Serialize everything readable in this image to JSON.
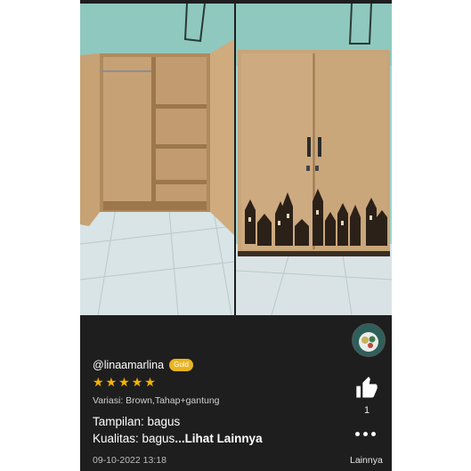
{
  "review": {
    "username": "@linaamarlina",
    "badge": "Gold",
    "rating": 5,
    "variant": "Variasi: Brown,Tahap+gantung",
    "line1": "Tampilan: bagus",
    "line2": "Kualitas: bagus",
    "more_link": "...Lihat Lainnya",
    "date": "09-10-2022 13:18"
  },
  "actions": {
    "like_count": "1",
    "more_label": "Lainnya",
    "like_icon": "thumbs-up-icon",
    "more_icon": "more-dots-icon"
  },
  "photos": [
    {
      "alt": "wardrobe-open-photo"
    },
    {
      "alt": "wardrobe-closed-photo"
    }
  ],
  "colors": {
    "background": "#1e1e1e",
    "badge": "#e9b321",
    "star": "#f5b400",
    "wood": "#c9a57a"
  }
}
